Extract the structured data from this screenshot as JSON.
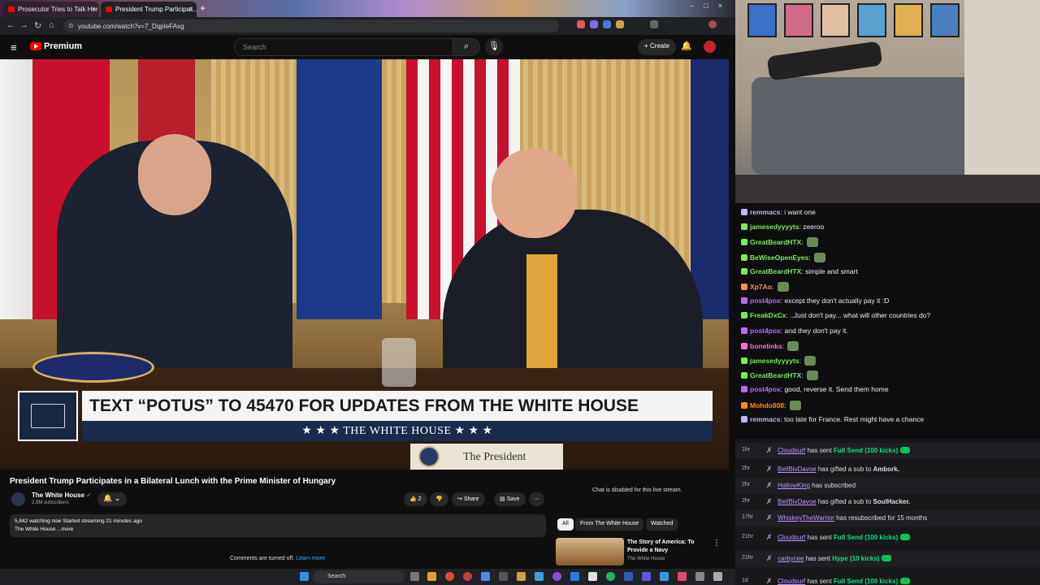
{
  "browser": {
    "tabs": [
      {
        "label": "Prosecutor Tries to Talk Her W..."
      },
      {
        "label": "President Trump Participat..."
      }
    ],
    "url": "youtube.com/watch?v=7_DqpIeFAxg"
  },
  "youtube": {
    "brand": "Premium",
    "search_placeholder": "Search",
    "create_label": "Create"
  },
  "video": {
    "lower_third": {
      "headline": "TEXT “POTUS” TO 45470 FOR UPDATES FROM THE WHITE HOUSE",
      "subline": "★ ★ ★  THE WHITE HOUSE  ★ ★ ★"
    },
    "placard": "The President",
    "title": "President Trump Participates in a Bilateral Lunch with the Prime Minister of Hungary",
    "channel": "The White House",
    "verified": "✓",
    "subscribers": "2.8M subscribers",
    "likes": "2",
    "share_label": "Share",
    "save_label": "Save",
    "description_line1": "5,842 watching now  Started streaming 21 minutes ago",
    "description_line2": "The White House ...more",
    "comments_off": "Comments are turned off.",
    "learn_more": "Learn more",
    "chat_disabled": "Chat is disabled for this live stream."
  },
  "recommendations": {
    "chips": [
      "All",
      "From The White House",
      "Watched"
    ],
    "active_chip": "All",
    "item": {
      "title": "The Story of America: To Provide a Navy",
      "channel": "The White House"
    }
  },
  "chat": {
    "messages": [
      {
        "user": "remmacs",
        "text": "i want one",
        "color": "#b9b9ff",
        "emote": false
      },
      {
        "user": "jamesedyyyyts",
        "text": "zeeroo",
        "color": "#7bea56",
        "emote": false
      },
      {
        "user": "GreatBeardHTX",
        "text": "",
        "color": "#7bea56",
        "emote": true
      },
      {
        "user": "BeWiseOpenEyes",
        "text": "",
        "color": "#7bea56",
        "emote": true
      },
      {
        "user": "GreatBeardHTX",
        "text": "simple and smart",
        "color": "#7bea56",
        "emote": false
      },
      {
        "user": "Xp7Ao",
        "text": "",
        "color": "#ff8a5c",
        "emote": true
      },
      {
        "user": "post4pox",
        "text": "except they don't actually pay it :D",
        "color": "#b66bff",
        "emote": false
      },
      {
        "user": "FreakDxCx",
        "text": "..Just don't pay... what will other countries do?",
        "color": "#7bea56",
        "emote": false
      },
      {
        "user": "post4pox",
        "text": "and they don't pay it.",
        "color": "#b66bff",
        "emote": false
      },
      {
        "user": "bonelinks",
        "text": "",
        "color": "#ff6bd9",
        "emote": true
      },
      {
        "user": "jamesedyyyyts",
        "text": "",
        "color": "#7bea56",
        "emote": true
      },
      {
        "user": "GreatBeardHTX",
        "text": "",
        "color": "#7bea56",
        "emote": true
      },
      {
        "user": "post4pox",
        "text": "good, reverse it. Send them home",
        "color": "#b66bff",
        "emote": false
      },
      {
        "user": "Mohdo808",
        "text": "",
        "color": "#ff8c00",
        "emote": true
      },
      {
        "user": "remmacs",
        "text": "too late for France. Rest might have a chance",
        "color": "#b9b9ff",
        "emote": false
      }
    ]
  },
  "events": [
    {
      "time": "1hr",
      "user": "Cloudsurf",
      "mid": "has sent",
      "hl": "Full Send (100 kicks)",
      "tail": "",
      "tag": true
    },
    {
      "time": "2hr",
      "user": "BellBivDavoe",
      "mid": "has gifted a sub to",
      "hl": "",
      "tail": "Ambork.",
      "tag": false
    },
    {
      "time": "2hr",
      "user": "HallowKing",
      "mid": "has subscribed",
      "hl": "",
      "tail": "",
      "tag": false
    },
    {
      "time": "2hr",
      "user": "BellBivDavoe",
      "mid": "has gifted a sub to",
      "hl": "",
      "tail": "SoulHacker.",
      "tag": false
    },
    {
      "time": "17hr",
      "user": "WhiskeyTheWarrior",
      "mid": "has resubscribed for 15 months",
      "hl": "",
      "tail": "",
      "tag": false
    },
    {
      "time": "21hr",
      "user": "Cloudsurf",
      "mid": "has sent",
      "hl": "Full Send (100 kicks)",
      "tail": "",
      "tag": true
    },
    {
      "time": "21hr",
      "user": "carbycee",
      "mid": "has sent",
      "hl": "Hype (10 kicks)",
      "tail": "",
      "tag": true
    },
    {
      "time": "1d",
      "user": "Cloudsurf",
      "mid": "has sent",
      "hl": "Full Send (100 kicks)",
      "tail": "",
      "tag": true
    }
  ],
  "taskbar": {
    "search_label": "Search"
  },
  "colors": {
    "yt_red": "#ff0000",
    "chat_bg": "#0e0e10",
    "events_bg": "#18181b",
    "highlight_green": "#00e87b",
    "user_purple": "#bf94ff"
  }
}
